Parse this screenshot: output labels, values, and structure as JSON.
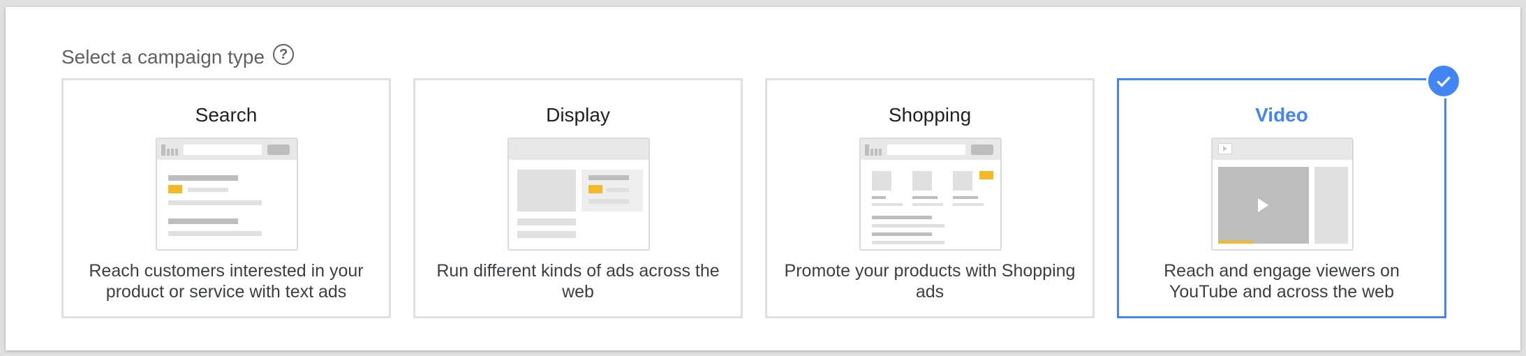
{
  "heading": {
    "label": "Select a campaign type",
    "help_icon": "help-circle-icon"
  },
  "campaign_types": [
    {
      "title": "Search",
      "description": "Reach customers interested in your product or service with text ads",
      "selected": false
    },
    {
      "title": "Display",
      "description": "Run different kinds of ads across the web",
      "selected": false
    },
    {
      "title": "Shopping",
      "description": "Promote your products with Shopping ads",
      "selected": false
    },
    {
      "title": "Video",
      "description": "Reach and engage viewers on YouTube and across the web",
      "selected": true
    }
  ],
  "colors": {
    "accent": "#4285f4",
    "highlight": "#f6b926",
    "card_border": "#e0e0e0"
  }
}
